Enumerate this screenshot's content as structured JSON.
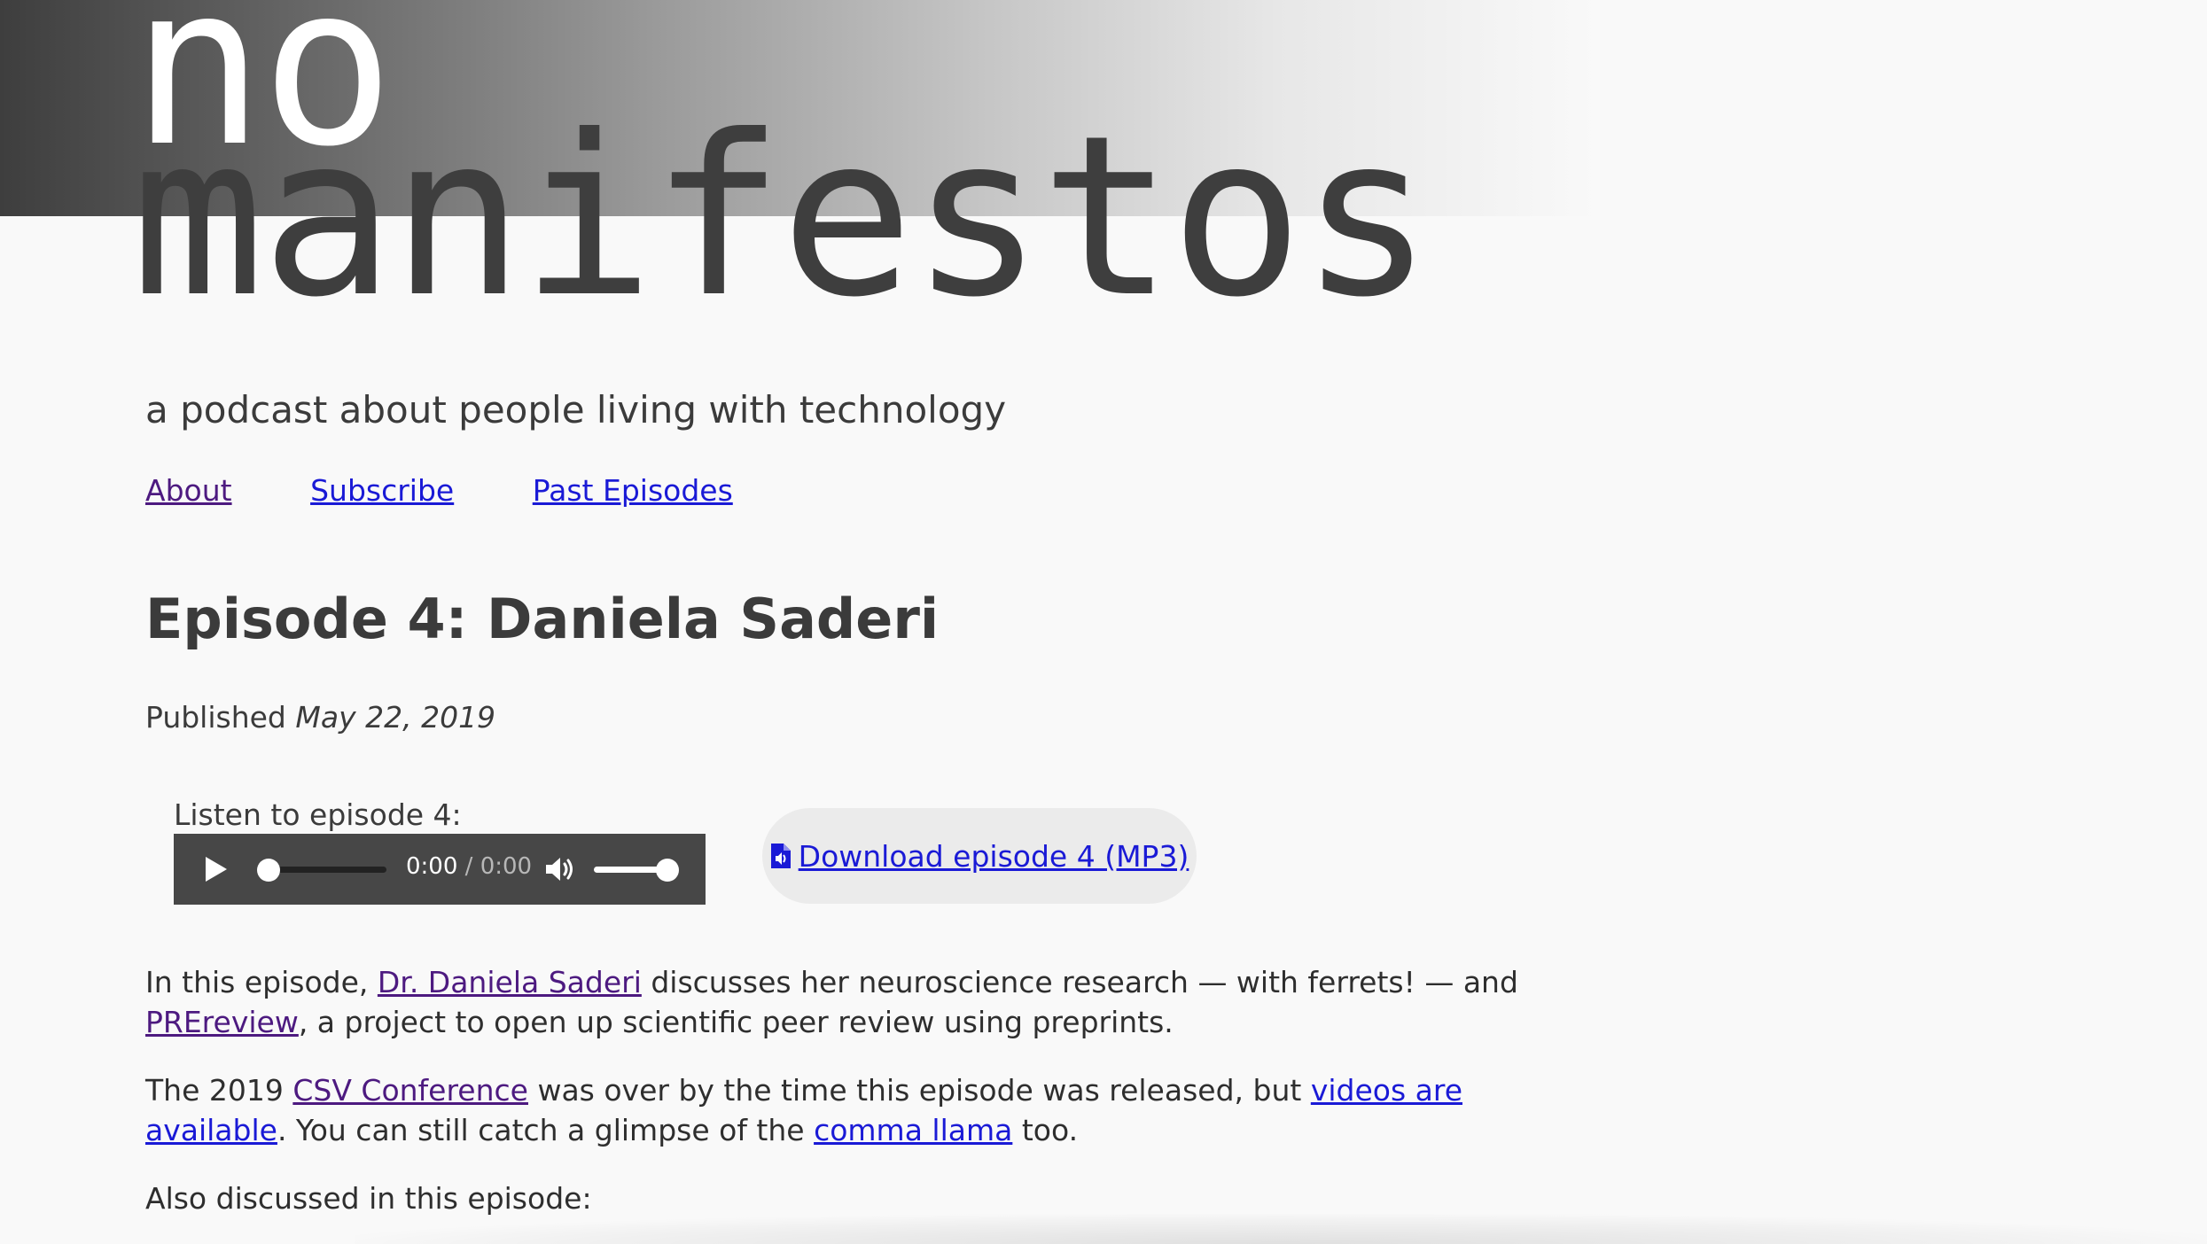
{
  "logo": {
    "line1": "no",
    "line2": "manifestos"
  },
  "tagline": "a podcast about people living with technology",
  "nav": {
    "items": [
      {
        "label": "About"
      },
      {
        "label": "Subscribe"
      },
      {
        "label": "Past Episodes"
      }
    ]
  },
  "episode": {
    "title": "Episode 4: Daniela Saderi",
    "published_prefix": "Published",
    "published_date": "May 22, 2019",
    "listen_label": "Listen to episode 4:",
    "download_label": "Download episode 4 (MP3)"
  },
  "player": {
    "current_time": "0:00",
    "separator": " / ",
    "duration": "0:00",
    "progress": 0,
    "volume": 1
  },
  "paragraphs": {
    "p1": {
      "t1": "In this episode, ",
      "link1": "Dr. Daniela Saderi",
      "t2": " discusses her neuroscience research — with ferrets! — and ",
      "link2": "PREreview",
      "t3": ", a project to open up scientific peer review using preprints."
    },
    "p2": {
      "t1": "The 2019 ",
      "link1": "CSV Conference",
      "t2": " was over by the time this episode was released, but ",
      "link2": "videos are available",
      "t3": ". You can still catch a glimpse of the ",
      "link3": "comma llama",
      "t4": " too."
    },
    "p3": {
      "text": "Also discussed in this episode:"
    }
  },
  "colors": {
    "link": "#1a1ad6",
    "visited_link": "#4d1a80",
    "text": "#3b3b3b",
    "player_bg": "#474747",
    "pill_bg": "#ebebeb"
  },
  "icons": {
    "play": "play-icon",
    "volume": "volume-icon",
    "file_audio": "file-audio-icon"
  }
}
